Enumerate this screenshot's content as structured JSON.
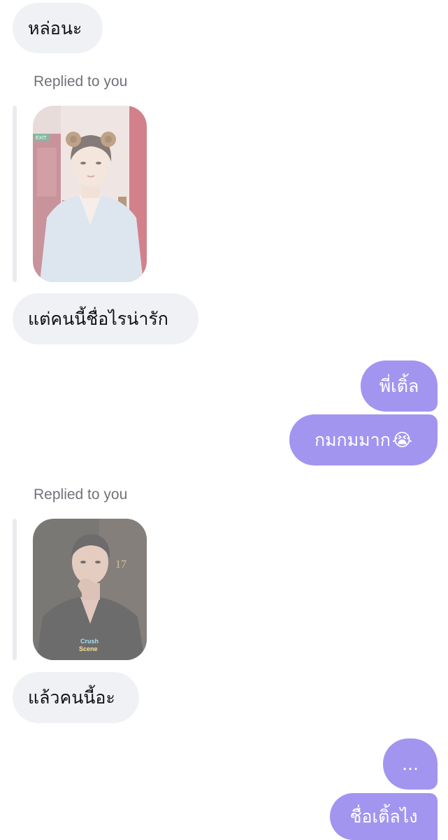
{
  "messages": {
    "m1": "หล่อนะ",
    "reply1_label": "Replied to you",
    "m2": "แต่คนนี้ชื่อไรน่ารัก",
    "m3": "พี่เติ้ล",
    "m4_text": "กมกมมาก",
    "m4_emoji": "😭",
    "reply2_label": "Replied to you",
    "m5": "แล้วคนนี้อะ",
    "m6": "...",
    "m7": "ชื่อเติ้ลไง"
  },
  "photo1": {
    "sign_text": "EXIT"
  },
  "photo2": {
    "logo_text_1": "Crush",
    "logo_text_2": "Scene",
    "wall_text": "17"
  },
  "colors": {
    "incoming_bubble": "#eff1f5",
    "outgoing_bubble": "#a295f0",
    "reply_label": "#6f7378",
    "reply_bar": "#e9ebef"
  },
  "icons": [
    "crying-face-emoji"
  ]
}
